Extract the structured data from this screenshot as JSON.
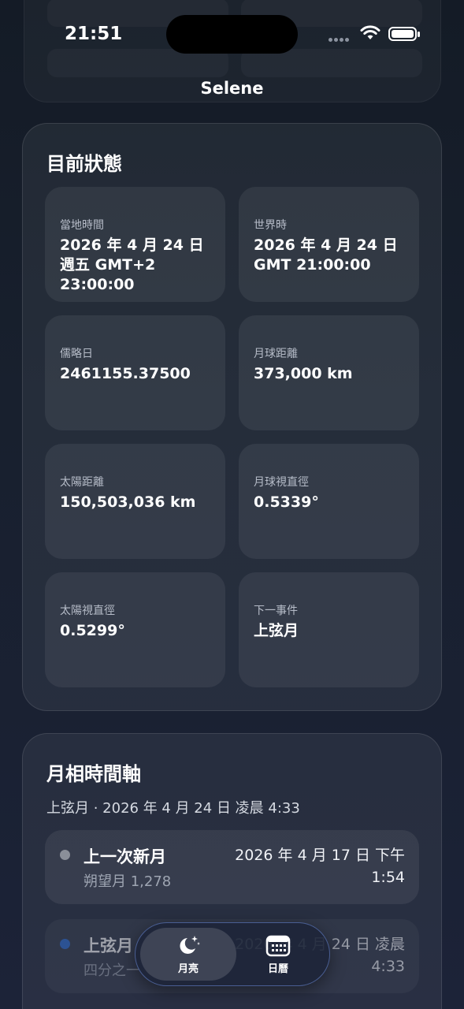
{
  "status_bar": {
    "time": "21:51"
  },
  "nav": {
    "title": "Selene"
  },
  "current_state": {
    "title": "目前狀態",
    "tiles": [
      {
        "label": "當地時間",
        "value": "2026 年 4 月 24 日週五 GMT+2 23:00:00"
      },
      {
        "label": "世界時",
        "value": "2026 年 4 月 24 日 GMT 21:00:00"
      },
      {
        "label": "儒略日",
        "value": "2461155.37500"
      },
      {
        "label": "月球距離",
        "value": "373,000 km"
      },
      {
        "label": "太陽距離",
        "value": "150,503,036 km"
      },
      {
        "label": "月球視直徑",
        "value": "0.5339°"
      },
      {
        "label": "太陽視直徑",
        "value": "0.5299°"
      },
      {
        "label": "下一事件",
        "value": "上弦月"
      }
    ]
  },
  "timeline": {
    "title": "月相時間軸",
    "subtitle": "上弦月 · 2026 年 4 月 24 日 凌晨 4:33",
    "events": [
      {
        "name": "上一次新月",
        "detail": "朔望月 1,278",
        "date": "2026 年 4 月 17 日 下午 1:54",
        "dot_color": "#8a8f99"
      },
      {
        "name": "上弦月",
        "detail": "四分之一",
        "date": "2026 年 4 月 24 日 凌晨 4:33",
        "dot_color": "#2f6fd6"
      }
    ]
  },
  "tab_bar": {
    "tabs": [
      {
        "label": "月亮",
        "icon": "moon-stars-icon",
        "active": true
      },
      {
        "label": "日曆",
        "icon": "calendar-icon",
        "active": false
      }
    ]
  },
  "colors": {
    "background": "#161d29",
    "accent": "#2f6fd6",
    "tab_border": "#6e8cdc"
  }
}
